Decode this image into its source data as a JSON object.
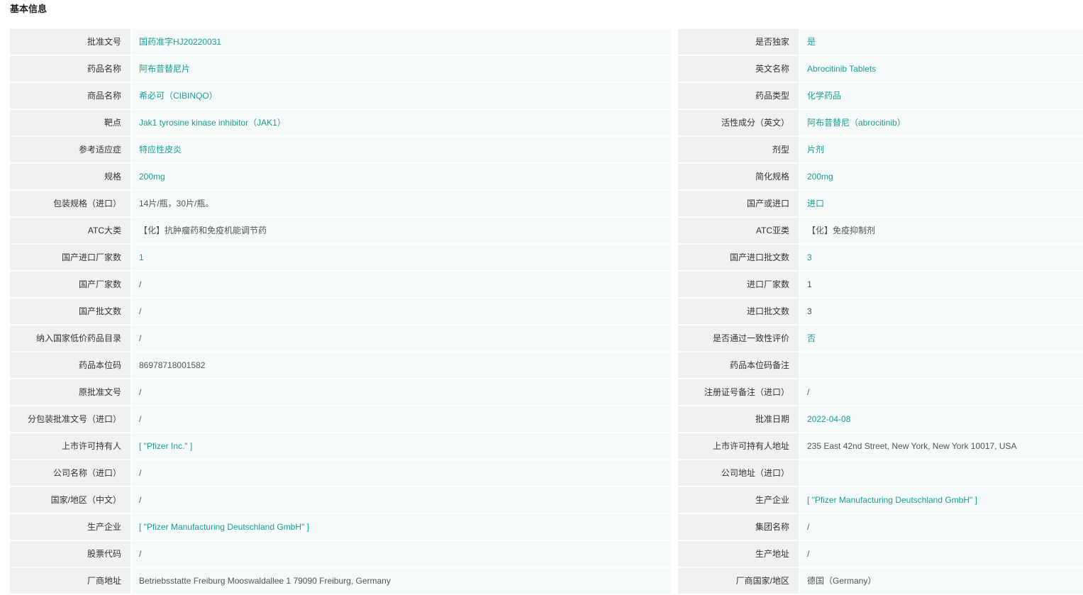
{
  "section_title": "基本信息",
  "colors": {
    "link": "#1a9e8f",
    "label_bg": "#f0f1f1",
    "value_bg": "#f5fbfb"
  },
  "rows": [
    {
      "l1": "批准文号",
      "v1": "国药准字HJ20220031",
      "v1_link": true,
      "l2": "是否独家",
      "v2": "是",
      "v2_link": true
    },
    {
      "l1": "药品名称",
      "v1": "阿布昔替尼片",
      "v1_link": true,
      "l2": "英文名称",
      "v2": "Abrocitinib Tablets",
      "v2_link": true
    },
    {
      "l1": "商品名称",
      "v1": "希必可（CIBINQO）",
      "v1_link": true,
      "l2": "药品类型",
      "v2": "化学药品",
      "v2_link": true
    },
    {
      "l1": "靶点",
      "v1": "Jak1 tyrosine kinase inhibitor（JAK1）",
      "v1_link": true,
      "l2": "活性成分（英文）",
      "v2": "阿布昔替尼（abrocitinib）",
      "v2_link": true
    },
    {
      "l1": "参考适应症",
      "v1": "特应性皮炎",
      "v1_link": true,
      "l2": "剂型",
      "v2": "片剂",
      "v2_link": true
    },
    {
      "l1": "规格",
      "v1": "200mg",
      "v1_link": true,
      "l2": "简化规格",
      "v2": "200mg",
      "v2_link": true
    },
    {
      "l1": "包装规格（进口）",
      "v1": "14片/瓶，30片/瓶。",
      "v1_link": false,
      "l2": "国产或进口",
      "v2": "进口",
      "v2_link": true
    },
    {
      "l1": "ATC大类",
      "v1": "【化】抗肿瘤药和免疫机能调节药",
      "v1_link": false,
      "l2": "ATC亚类",
      "v2": "【化】免疫抑制剂",
      "v2_link": false
    },
    {
      "l1": "国产进口厂家数",
      "v1": "1",
      "v1_link": true,
      "l2": "国产进口批文数",
      "v2": "3",
      "v2_link": true
    },
    {
      "l1": "国产厂家数",
      "v1": "/",
      "v1_link": false,
      "l2": "进口厂家数",
      "v2": "1",
      "v2_link": false
    },
    {
      "l1": "国产批文数",
      "v1": "/",
      "v1_link": false,
      "l2": "进口批文数",
      "v2": "3",
      "v2_link": false
    },
    {
      "l1": "纳入国家低价药品目录",
      "v1": "/",
      "v1_link": false,
      "l2": "是否通过一致性评价",
      "v2": "否",
      "v2_link": true
    },
    {
      "l1": "药品本位码",
      "v1": "86978718001582",
      "v1_link": false,
      "l2": "药品本位码备注",
      "v2": "",
      "v2_link": false
    },
    {
      "l1": "原批准文号",
      "v1": "/",
      "v1_link": false,
      "l2": "注册证号备注（进口）",
      "v2": "/",
      "v2_link": false
    },
    {
      "l1": "分包装批准文号（进口）",
      "v1": "/",
      "v1_link": false,
      "l2": "批准日期",
      "v2": "2022-04-08",
      "v2_link": true
    },
    {
      "l1": "上市许可持有人",
      "v1": "[ \"Pfizer Inc.\" ]",
      "v1_link": true,
      "l2": "上市许可持有人地址",
      "v2": "235 East 42nd Street, New York, New York 10017, USA",
      "v2_link": false
    },
    {
      "l1": "公司名称（进口）",
      "v1": "/",
      "v1_link": false,
      "l2": "公司地址（进口）",
      "v2": "",
      "v2_link": false
    },
    {
      "l1": "国家/地区（中文）",
      "v1": "/",
      "v1_link": false,
      "l2": "生产企业",
      "v2": "[ \"Pfizer Manufacturing Deutschland GmbH\" ]",
      "v2_link": true
    },
    {
      "l1": "生产企业",
      "v1": "[ \"Pfizer Manufacturing Deutschland GmbH\" ]",
      "v1_link": true,
      "l2": "集团名称",
      "v2": "/",
      "v2_link": false
    },
    {
      "l1": "股票代码",
      "v1": "/",
      "v1_link": false,
      "l2": "生产地址",
      "v2": "/",
      "v2_link": false
    },
    {
      "l1": "厂商地址",
      "v1": "Betriebsstatte Freiburg Mooswaldallee 1 79090 Freiburg, Germany",
      "v1_link": false,
      "l2": "厂商国家/地区",
      "v2": "德国（Germany）",
      "v2_link": false
    }
  ]
}
